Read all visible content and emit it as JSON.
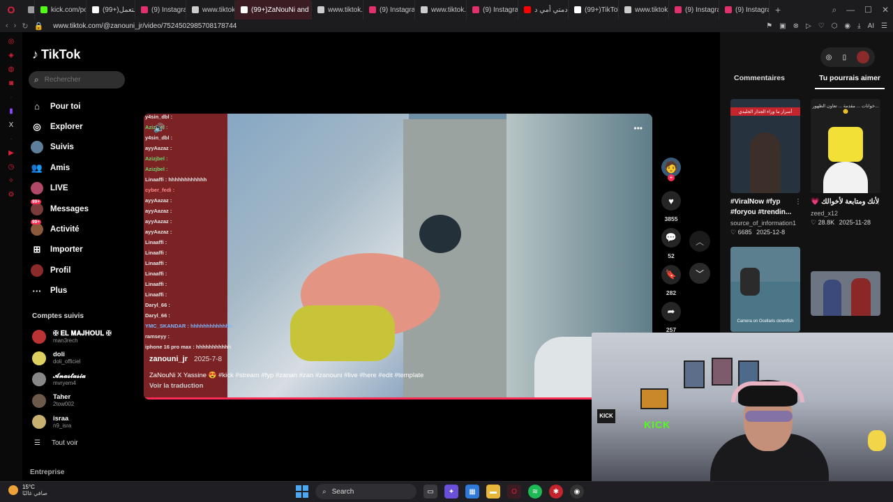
{
  "browser": {
    "tabs": [
      {
        "label": "",
        "icon": "tab-group-icon",
        "color": "#9a9a9a"
      },
      {
        "label": "kick.com/po",
        "icon": "kick-icon",
        "color": "#53fc18"
      },
      {
        "label": "(99+)شتعمل",
        "icon": "tiktok-icon",
        "color": "#ffffff"
      },
      {
        "label": "(9) Instagram",
        "icon": "instagram-icon",
        "color": "#e1306c"
      },
      {
        "label": "www.tiktok.c",
        "icon": "page-icon",
        "color": "#cccccc"
      },
      {
        "label": "(99+)ZaNouNi and",
        "icon": "tiktok-icon",
        "color": "#ffffff",
        "active": true
      },
      {
        "label": "www.tiktok.c",
        "icon": "page-icon",
        "color": "#cccccc"
      },
      {
        "label": "(9) Instagram",
        "icon": "instagram-icon",
        "color": "#e1306c"
      },
      {
        "label": "www.tiktok.c",
        "icon": "page-icon",
        "color": "#cccccc"
      },
      {
        "label": "(9) Instagram",
        "icon": "instagram-icon",
        "color": "#e1306c"
      },
      {
        "label": "دمتي أمي د...",
        "icon": "youtube-icon",
        "color": "#ff0000"
      },
      {
        "label": "(99+)TikTok",
        "icon": "tiktok-icon",
        "color": "#ffffff"
      },
      {
        "label": "www.tiktok.c",
        "icon": "page-icon",
        "color": "#cccccc"
      },
      {
        "label": "(9) Instagram",
        "icon": "instagram-icon",
        "color": "#e1306c"
      },
      {
        "label": "(9) Instagram",
        "icon": "instagram-icon",
        "color": "#e1306c"
      }
    ],
    "url": "www.tiktok.com/@zanouni_jr/video/7524502985708178744",
    "ai_label": "AI"
  },
  "tiktok": {
    "logo": "TikTok",
    "search_placeholder": "Rechercher",
    "menu": [
      {
        "label": "Pour toi",
        "icon": "home-icon"
      },
      {
        "label": "Explorer",
        "icon": "compass-icon"
      },
      {
        "label": "Suivis",
        "icon": "following-avatar",
        "badge": ""
      },
      {
        "label": "Amis",
        "icon": "friends-icon"
      },
      {
        "label": "LIVE",
        "icon": "live-avatar"
      },
      {
        "label": "Messages",
        "icon": "messages-avatar",
        "badge": "99+"
      },
      {
        "label": "Activité",
        "icon": "activity-avatar",
        "badge": "99+"
      },
      {
        "label": "Importer",
        "icon": "upload-icon"
      },
      {
        "label": "Profil",
        "icon": "profile-avatar"
      },
      {
        "label": "Plus",
        "icon": "more-icon"
      }
    ],
    "following_title": "Comptes suivis",
    "following": [
      {
        "name": "✠ 𝐄𝐋 𝐌𝐀𝐉𝐇𝐎𝐔𝐋 ✠",
        "handle": "man3rech",
        "color": "#b33"
      },
      {
        "name": "doli",
        "handle": "doli_officiel",
        "color": "#ddd060"
      },
      {
        "name": "𝓐𝓷𝓪𝓼𝓽𝓪𝓼𝓲𝓪",
        "handle": "mvryem4",
        "color": "#888"
      },
      {
        "name": "Taher",
        "handle": "2tow002",
        "color": "#6d5a4a"
      },
      {
        "name": "israa",
        "handle": "n9_isra",
        "color": "#c8b070"
      }
    ],
    "see_all": "Tout voir",
    "entreprise": "Entreprise"
  },
  "video": {
    "chat": [
      {
        "name": "y4sin_dbl :",
        "color": "#e6e6e6"
      },
      {
        "name": "Azizjbel :",
        "color": "#6fd86f"
      },
      {
        "name": "y4sin_dbl :",
        "color": "#e6e6e6"
      },
      {
        "name": "ayyAazaz :",
        "color": "#e6e6e6"
      },
      {
        "name": "Azizjbel :",
        "color": "#6fd86f"
      },
      {
        "name": "Azizjbel :",
        "color": "#6fd86f"
      },
      {
        "name": "Linaaffi : hhhhhhhhhhhh",
        "color": "#e6e6e6"
      },
      {
        "name": "cyber_fedi :",
        "color": "#ff8a8a"
      },
      {
        "name": "ayyAazaz :",
        "color": "#e6e6e6"
      },
      {
        "name": "ayyAazaz :",
        "color": "#e6e6e6"
      },
      {
        "name": "ayyAazaz :",
        "color": "#e6e6e6"
      },
      {
        "name": "ayyAazaz :",
        "color": "#e6e6e6"
      },
      {
        "name": "Linaaffi :",
        "color": "#e6e6e6"
      },
      {
        "name": "Linaaffi :",
        "color": "#e6e6e6"
      },
      {
        "name": "Linaaffi :",
        "color": "#e6e6e6"
      },
      {
        "name": "Linaaffi :",
        "color": "#e6e6e6"
      },
      {
        "name": "Linaaffi :",
        "color": "#e6e6e6"
      },
      {
        "name": "Linaaffi :",
        "color": "#e6e6e6"
      },
      {
        "name": "Daryl_66 :",
        "color": "#e6e6e6"
      },
      {
        "name": "Daryl_66 :",
        "color": "#e6e6e6"
      },
      {
        "name": "YMC_SKANDAR : hhhhhhhhhhhhh",
        "color": "#7fb8ff"
      },
      {
        "name": "ramseyy :",
        "color": "#e6e6e6"
      },
      {
        "name": "iphone 16 pro max : hhhhhhhhhhh",
        "color": "#e6e6e6"
      }
    ],
    "author": "zanouni_jr",
    "date": "2025-7-8",
    "description": "ZaNouNi X Yassine 😍 #kick #stream #fyp #zanan #zan #zanouni #live #here #edit #template",
    "translate": "Voir la traduction"
  },
  "actions": {
    "likes": "3855",
    "comments": "52",
    "saves": "282",
    "shares": "257"
  },
  "right_panel": {
    "tabs": [
      "Commentaires",
      "Tu pourrais aimer"
    ],
    "active_tab": 1,
    "cards": [
      {
        "title": "#ViralNow #fyp #foryou #trendin...",
        "author": "source_of_information1",
        "likes": "6685",
        "date": "2025-12-8",
        "thumb_text": "أسرار ما وراء الجدار الجليدي",
        "thumb_color": "#27323f"
      },
      {
        "title": "لأنك ومتابعة لأخوالك 💗",
        "author": "zeed_x12",
        "likes": "28.8K",
        "date": "2025-11-28",
        "thumb_text": "خوانات ... مقدمة ... تعاون الظهور... 🙂",
        "thumb_color": "#1d1d1d"
      },
      {
        "title": "",
        "author": "",
        "likes": "",
        "date": "",
        "thumb_text": "Camera on Ocellaris clownfish",
        "thumb_color": "#5b7f8e"
      },
      {
        "title": "",
        "author": "",
        "likes": "",
        "date": "",
        "thumb_text": "",
        "thumb_color": "#6d7482"
      }
    ]
  },
  "webcam": {
    "neon_text": "KICK",
    "kick_text": "KICK"
  },
  "taskbar": {
    "weather_temp": "15°C",
    "weather_text": "صافي غالبًا",
    "search_label": "Search"
  }
}
